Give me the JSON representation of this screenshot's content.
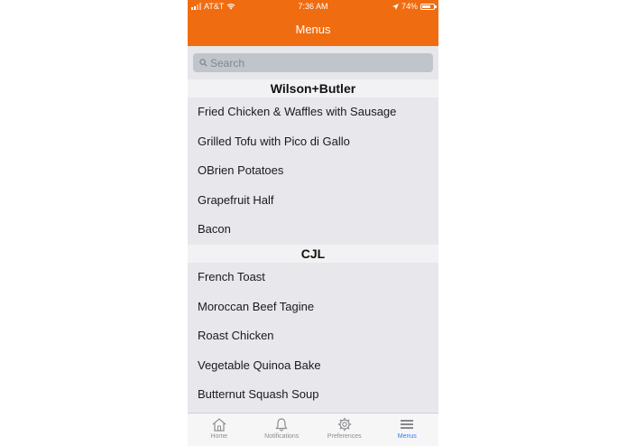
{
  "status_bar": {
    "carrier": "AT&T",
    "time": "7:36 AM",
    "battery_percent": "74%",
    "battery_level": 0.74
  },
  "navbar": {
    "title": "Menus"
  },
  "search": {
    "placeholder": "Search"
  },
  "sections": [
    {
      "title": "Wilson+Butler",
      "items": [
        "Fried Chicken & Waffles with Sausage",
        "Grilled Tofu with Pico di Gallo",
        "OBrien Potatoes",
        "Grapefruit Half",
        "Bacon"
      ]
    },
    {
      "title": "CJL",
      "items": [
        "French Toast",
        "Moroccan Beef Tagine",
        "Roast Chicken",
        "Vegetable Quinoa Bake",
        "Butternut Squash Soup"
      ]
    }
  ],
  "tabbar": {
    "tabs": [
      {
        "label": "Home",
        "icon": "home-icon"
      },
      {
        "label": "Notifications",
        "icon": "bell-icon"
      },
      {
        "label": "Preferences",
        "icon": "gear-icon"
      },
      {
        "label": "Menus",
        "icon": "menu-icon",
        "active": true
      }
    ]
  },
  "colors": {
    "accent": "#f06c10",
    "active_tab": "#2f7cf6"
  }
}
